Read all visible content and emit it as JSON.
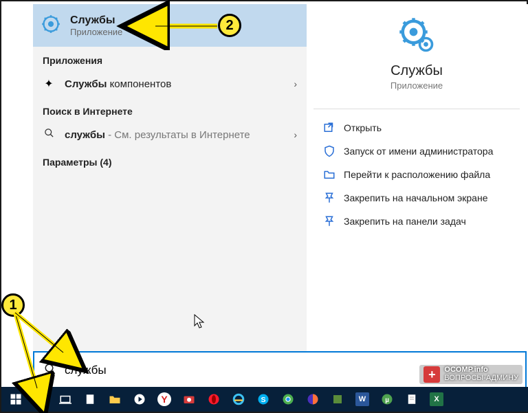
{
  "best_match": {
    "title": "Службы",
    "subtitle": "Приложение"
  },
  "sections": {
    "apps_header": "Приложения",
    "app_item_prefix": "Службы ",
    "app_item_suffix": "компонентов",
    "web_header": "Поиск в Интернете",
    "web_item_prefix": "службы",
    "web_item_suffix": " - См. результаты в Интернете",
    "params_header": "Параметры (4)"
  },
  "right": {
    "title": "Службы",
    "subtitle": "Приложение",
    "actions": [
      "Открыть",
      "Запуск от имени администратора",
      "Перейти к расположению файла",
      "Закрепить на начальном экране",
      "Закрепить на панели задач"
    ]
  },
  "search_value": "службы",
  "callouts": {
    "one": "1",
    "two": "2"
  },
  "watermark": {
    "line1": "OCOMP.info",
    "line2": "ВОПРОСЫ-АДМИНУ"
  }
}
